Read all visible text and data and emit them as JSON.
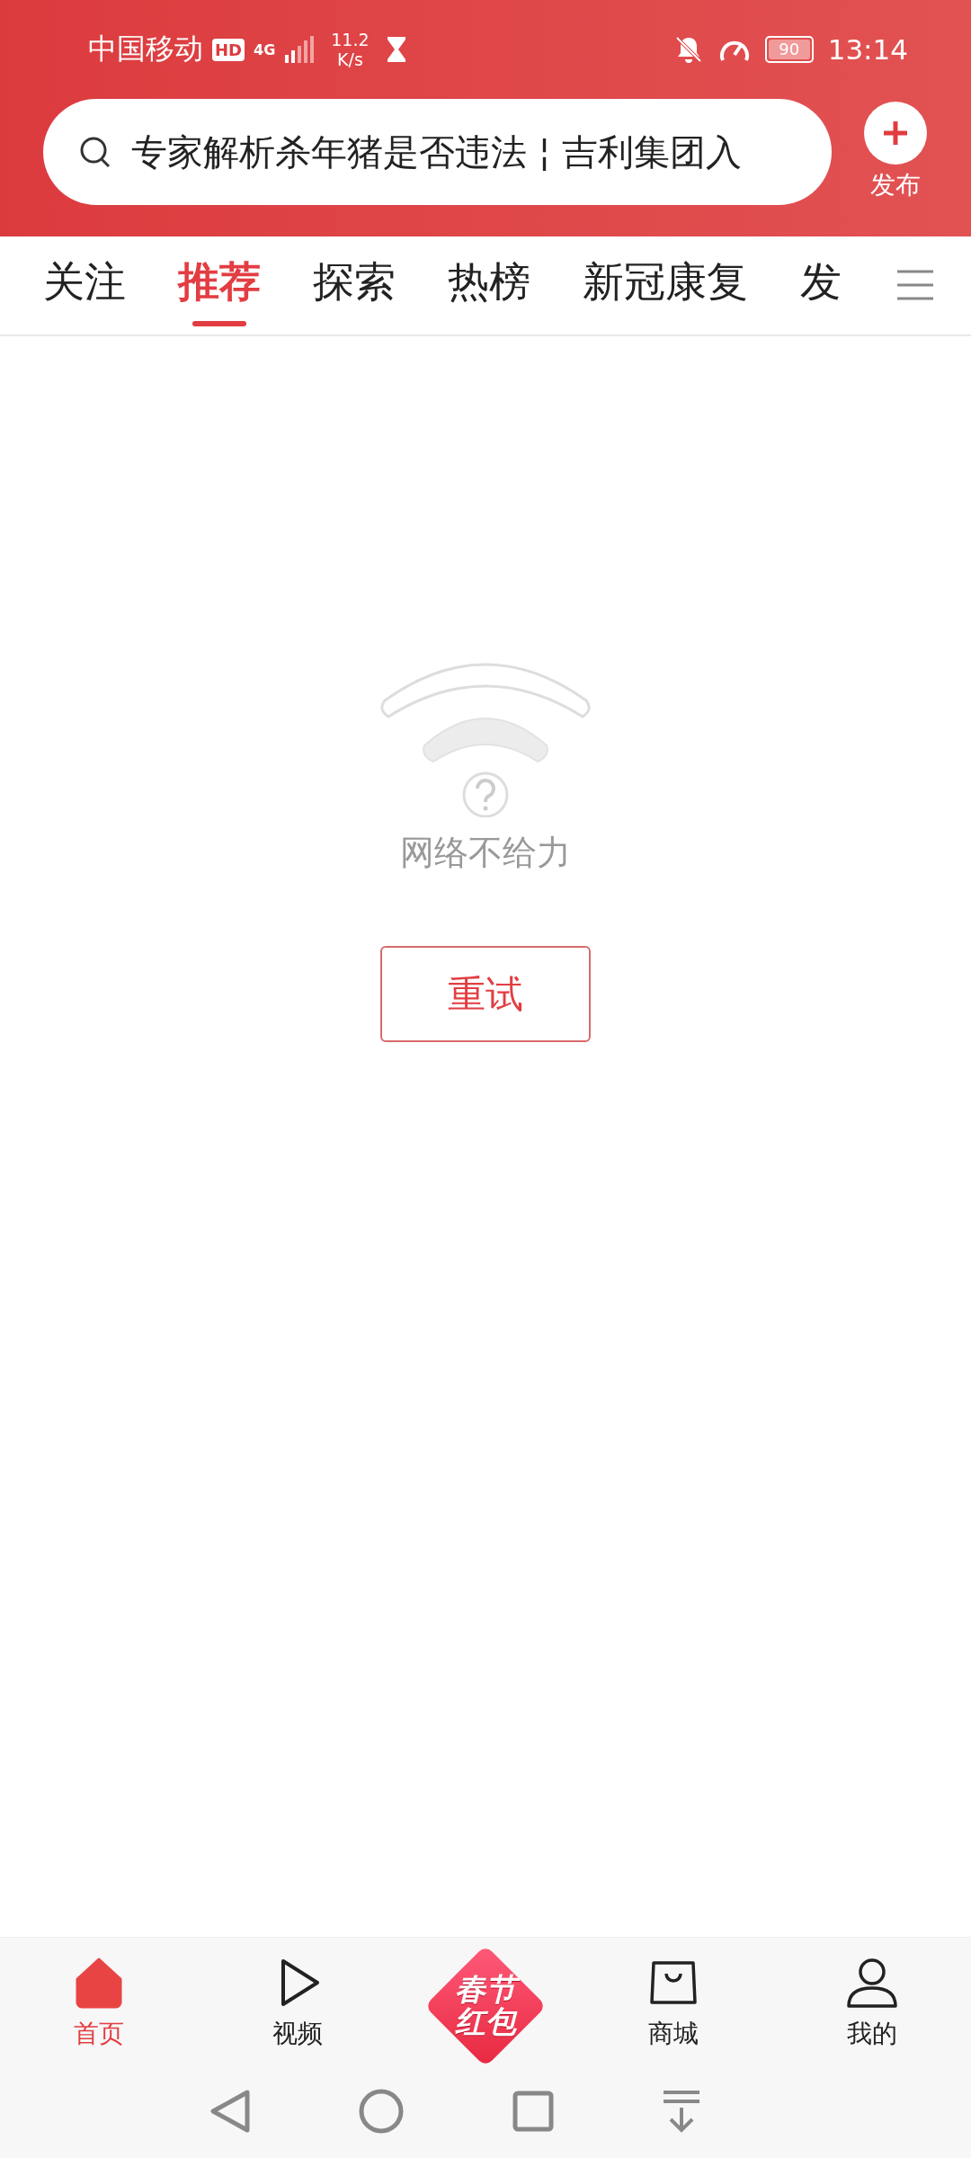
{
  "status_bar": {
    "carrier": "中国移动",
    "hd": "HD",
    "network": "4G",
    "speed_value": "11.2",
    "speed_unit": "K/s",
    "battery": "90",
    "time": "13:14"
  },
  "search": {
    "value": "专家解析杀年猪是否违法 ¦ 吉利集团入"
  },
  "publish": {
    "label": "发布"
  },
  "tabs": [
    {
      "label": "关注",
      "selected": false
    },
    {
      "label": "推荐",
      "selected": true
    },
    {
      "label": "探索",
      "selected": false
    },
    {
      "label": "热榜",
      "selected": false
    },
    {
      "label": "新冠康复",
      "selected": false
    },
    {
      "label": "发",
      "selected": false
    }
  ],
  "error": {
    "message": "网络不给力",
    "retry": "重试"
  },
  "bottom_nav": [
    {
      "kind": "home",
      "label": "首页",
      "selected": true
    },
    {
      "kind": "video",
      "label": "视频",
      "selected": false
    },
    {
      "kind": "promo",
      "label": "春节红包",
      "selected": false
    },
    {
      "kind": "shop",
      "label": "商城",
      "selected": false
    },
    {
      "kind": "me",
      "label": "我的",
      "selected": false
    }
  ]
}
